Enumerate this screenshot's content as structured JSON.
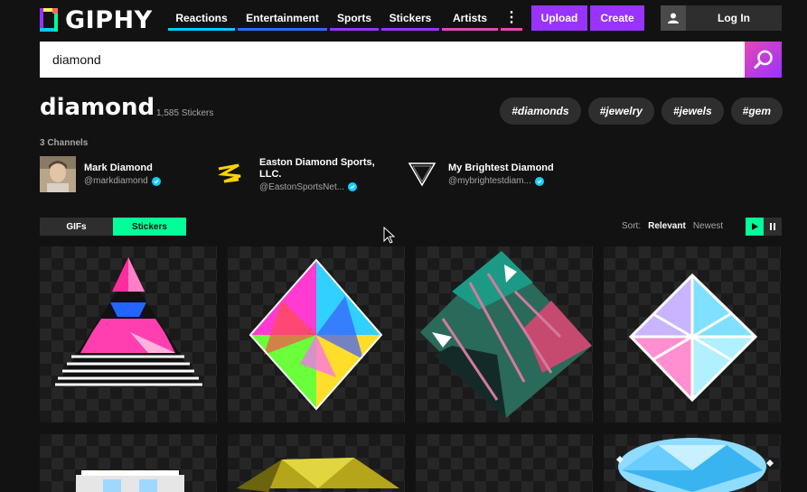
{
  "logo": {
    "text": "GIPHY"
  },
  "nav": {
    "items": [
      {
        "label": "Reactions",
        "color": "#00ccff"
      },
      {
        "label": "Entertainment",
        "color": "#3366ff"
      },
      {
        "label": "Sports",
        "color": "#9933ff"
      },
      {
        "label": "Stickers",
        "color": "#9933ff"
      },
      {
        "label": "Artists",
        "color": "#e646b6"
      }
    ],
    "more_label": "⋮",
    "upload_label": "Upload",
    "create_label": "Create",
    "login_label": "Log In"
  },
  "search": {
    "value": "diamond",
    "icon": "search-icon"
  },
  "results": {
    "title": "diamond",
    "count": "1,585 Stickers",
    "tags": [
      "#diamonds",
      "#jewelry",
      "#jewels",
      "#gem"
    ]
  },
  "channels": {
    "label": "3 Channels",
    "items": [
      {
        "name": "Mark Diamond",
        "handle": "@markdiamond"
      },
      {
        "name": "Easton Diamond Sports, LLC.",
        "handle": "@EastonSportsNet..."
      },
      {
        "name": "My Brightest Diamond",
        "handle": "@mybrightestdiam..."
      }
    ]
  },
  "filters": {
    "gifs_label": "GIFs",
    "stickers_label": "Stickers",
    "sort_label": "Sort:",
    "sort_relevant": "Relevant",
    "sort_newest": "Newest"
  },
  "colors": {
    "accent_purple": "#9933ff",
    "accent_green": "#00ff99",
    "accent_pink": "#e646b6",
    "verified_blue": "#15cdff",
    "background": "#121212"
  }
}
